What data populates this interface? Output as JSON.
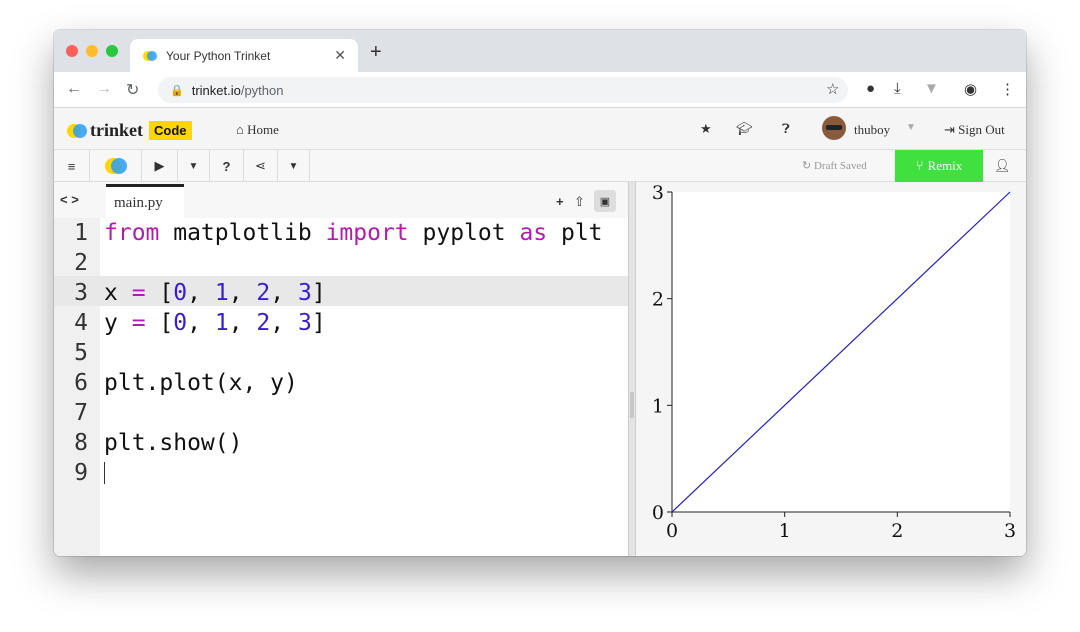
{
  "browser": {
    "tab_title": "Your Python Trinket",
    "url_host": "trinket.io",
    "url_path": "/python",
    "icons": [
      "back-arrow",
      "forward-arrow",
      "reload",
      "lock",
      "star",
      "github",
      "download",
      "filter",
      "account",
      "menu"
    ]
  },
  "site": {
    "logo_word": "trinket",
    "logo_badge": "Code",
    "home_label": "Home",
    "username": "thuboy",
    "signout_label": "Sign Out"
  },
  "toolbar": {
    "run_icon": "play",
    "help_label": "?",
    "draft_label": "Draft Saved",
    "remix_label": "Remix"
  },
  "editor": {
    "file_tab": "main.py",
    "code_toggle": "< >",
    "line_numbers": [
      "1",
      "2",
      "3",
      "4",
      "5",
      "6",
      "7",
      "8",
      "9"
    ],
    "lines": [
      "from matplotlib import pyplot as plt",
      "",
      "x = [0, 1, 2, 3]",
      "y = [0, 1, 2, 3]",
      "",
      "plt.plot(x, y)",
      "",
      "plt.show()",
      ""
    ],
    "active_line": 9
  },
  "colors": {
    "remix": "#3fe13f",
    "keyword": "#b01cad",
    "number": "#3a1cd0",
    "line": "#1f1fbf",
    "code_badge": "#ffd600"
  },
  "chart_data": {
    "type": "line",
    "x": [
      0,
      1,
      2,
      3
    ],
    "series": [
      {
        "values": [
          0,
          1,
          2,
          3
        ]
      }
    ],
    "xticks": [
      "0",
      "1",
      "2",
      "3"
    ],
    "yticks": [
      "0",
      "1",
      "2",
      "3"
    ],
    "xlim": [
      0,
      3
    ],
    "ylim": [
      0,
      3
    ],
    "grid": false
  }
}
